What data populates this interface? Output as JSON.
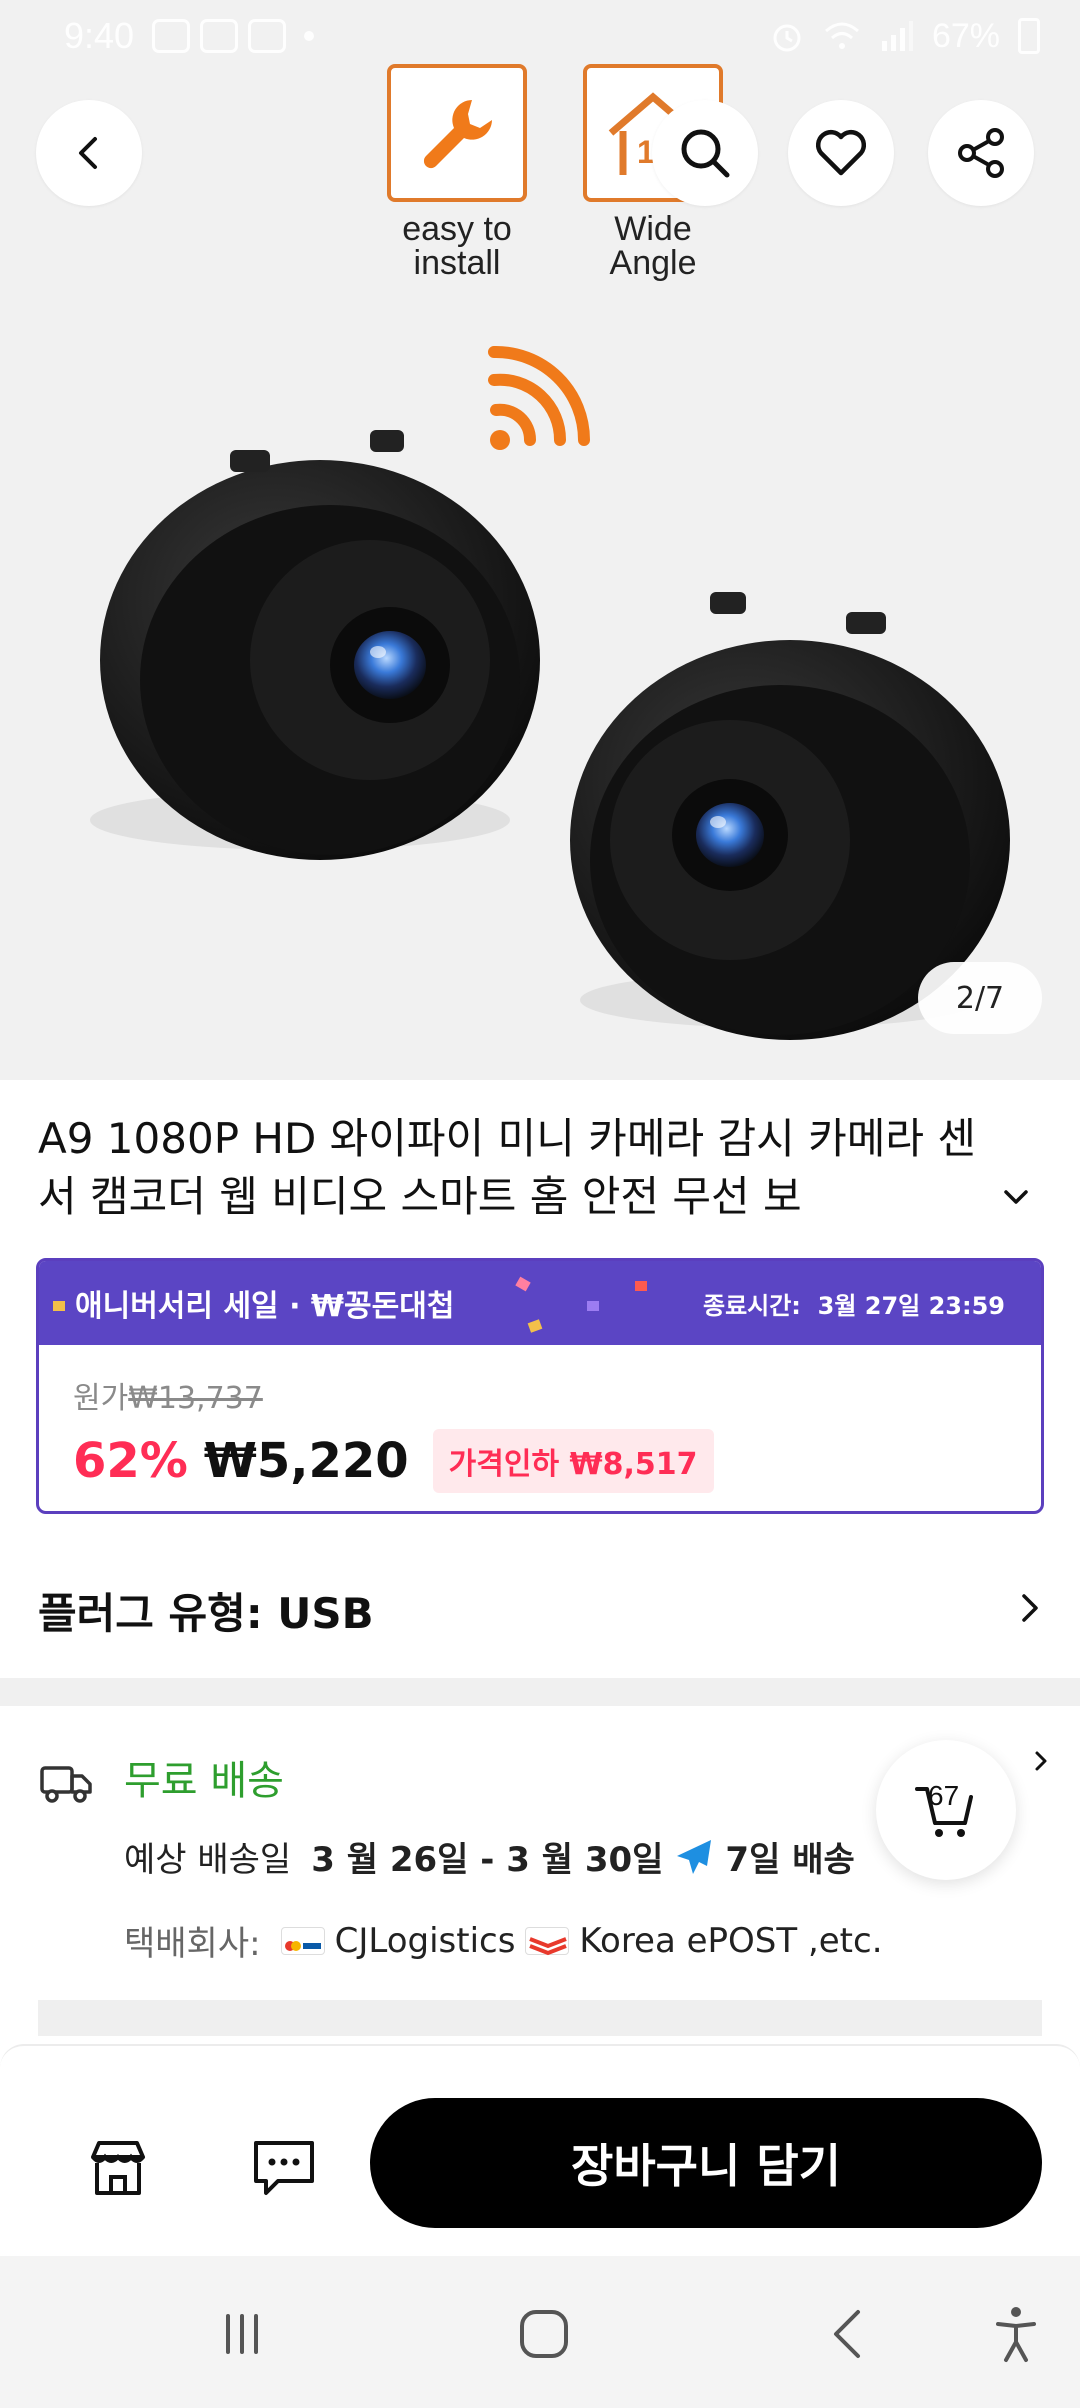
{
  "status_bar": {
    "time": "9:40",
    "battery": "67%"
  },
  "hero": {
    "features": [
      {
        "label_line1": "easy to",
        "label_line2": "install"
      },
      {
        "label_line1": "Wide",
        "label_line2": "Angle",
        "icon_number": "150"
      }
    ],
    "image_counter": "2/7",
    "icons": [
      "back-icon",
      "search-icon",
      "heart-icon",
      "share-icon"
    ]
  },
  "product": {
    "title": "A9 1080P HD 와이파이 미니 카메라 감시 카메라 센서 캠코더 웹 비디오 스마트 홈 안전 무선 보"
  },
  "sale": {
    "name": "애니버서리 세일 · ₩꽁돈대첩",
    "end_label": "종료시간:",
    "end_time": "3월 27일 23:59",
    "orig_label": "원가",
    "orig_price": "₩13,737",
    "discount": "62%",
    "price": "₩5,220",
    "drop_badge": "가격인하 ₩8,517",
    "accent": "#5b45c4",
    "price_color": "#ff2d55"
  },
  "plug": {
    "label": "플러그 유형: USB"
  },
  "shipping": {
    "free_label": "무료 배송",
    "eta_label": "예상 배송일",
    "eta_dates": "3 월 26일 - 3 월 30일",
    "eta_days": "7일 배송",
    "courier_label": "택배회사:",
    "courier_1": "CJLogistics",
    "courier_2": "Korea ePOST ,etc.",
    "free_color": "#2e9e2e"
  },
  "cart_fab": {
    "count": "67"
  },
  "actions": {
    "add_to_cart": "장바구니 담기"
  }
}
